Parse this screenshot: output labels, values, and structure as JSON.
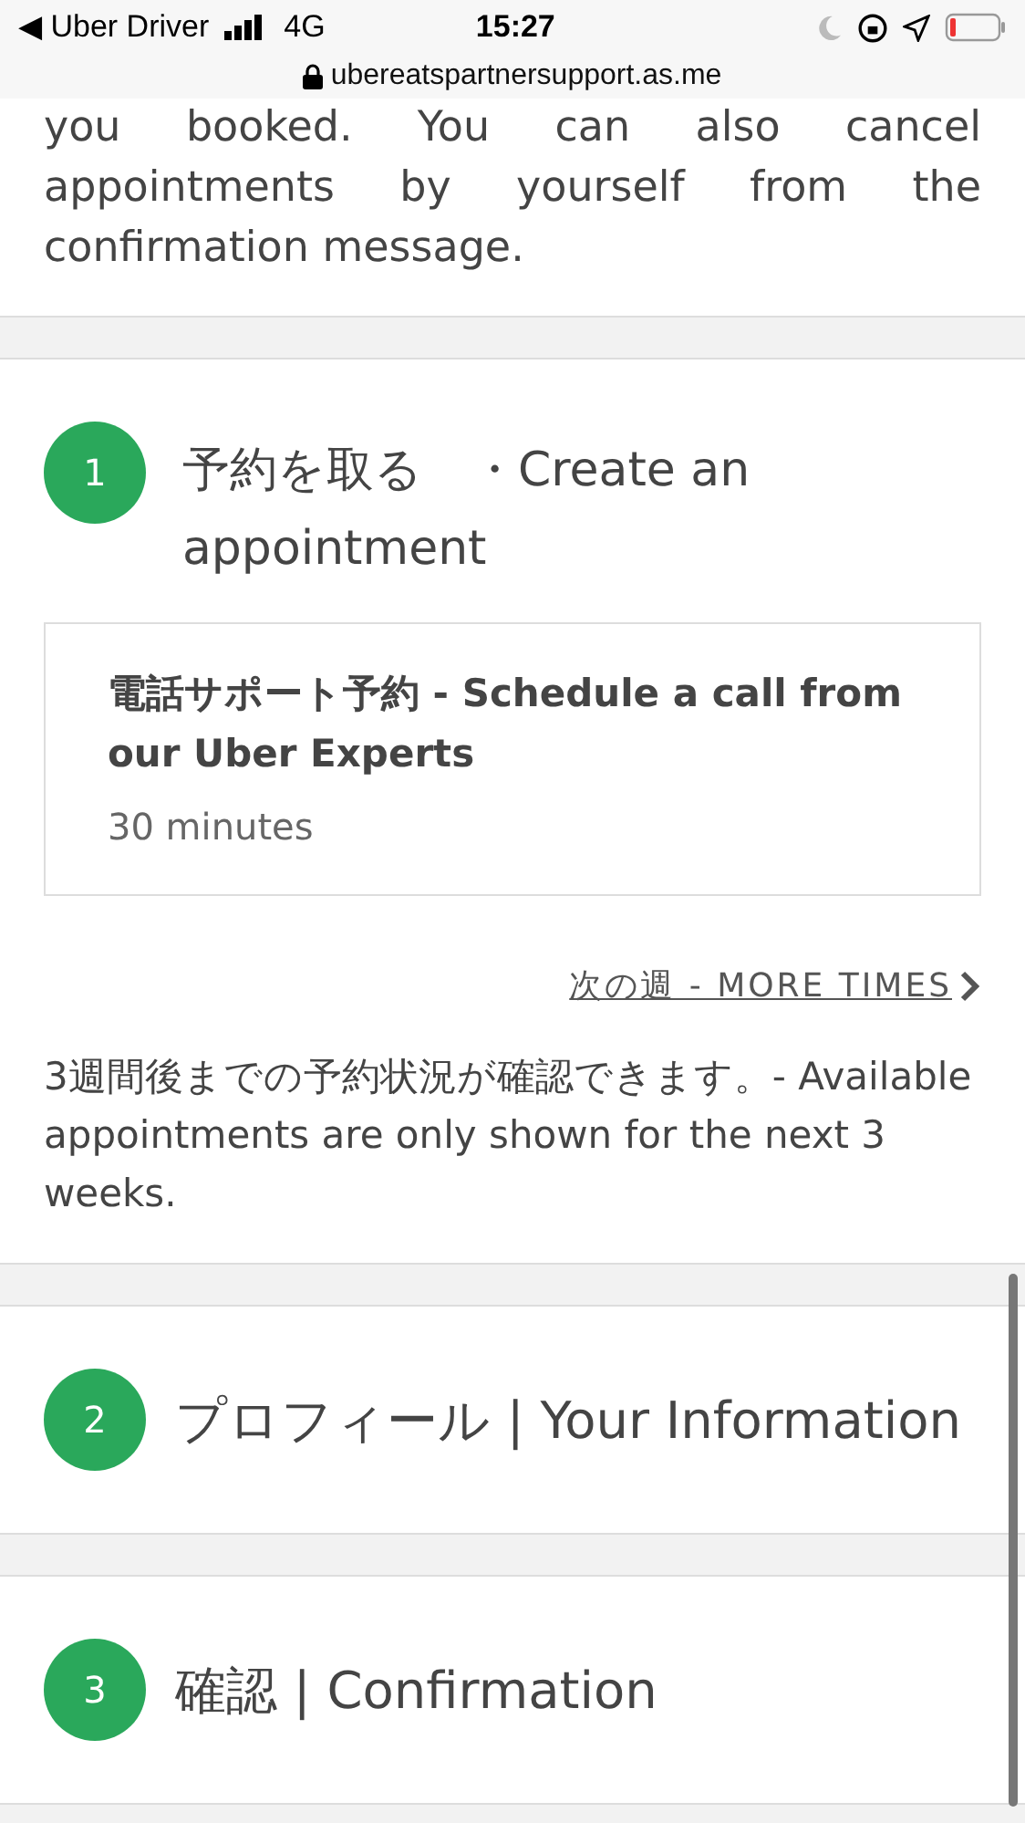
{
  "status_bar": {
    "back_app": "◀ Uber Driver",
    "network": "4G",
    "time": "15:27",
    "url": "ubereatspartnersupport.as.me"
  },
  "intro": {
    "text": "you booked. You can also cancel appointments by yourself from the confirmation message."
  },
  "steps": [
    {
      "number": "1",
      "title": "予約を取る　・Create an appointment",
      "kind": "expanded",
      "service": {
        "title": "電話サポート予約 - Schedule a call from our Uber Experts",
        "duration": "30 minutes"
      },
      "more_link": "次の週 - MORE TIMES",
      "note": "3週間後までの予約状況が確認できます。- Available appointments are only shown for the next 3 weeks."
    },
    {
      "number": "2",
      "title": "プロフィール | Your Information",
      "kind": "collapsed"
    },
    {
      "number": "3",
      "title": "確認 | Confirmation",
      "kind": "collapsed"
    }
  ]
}
